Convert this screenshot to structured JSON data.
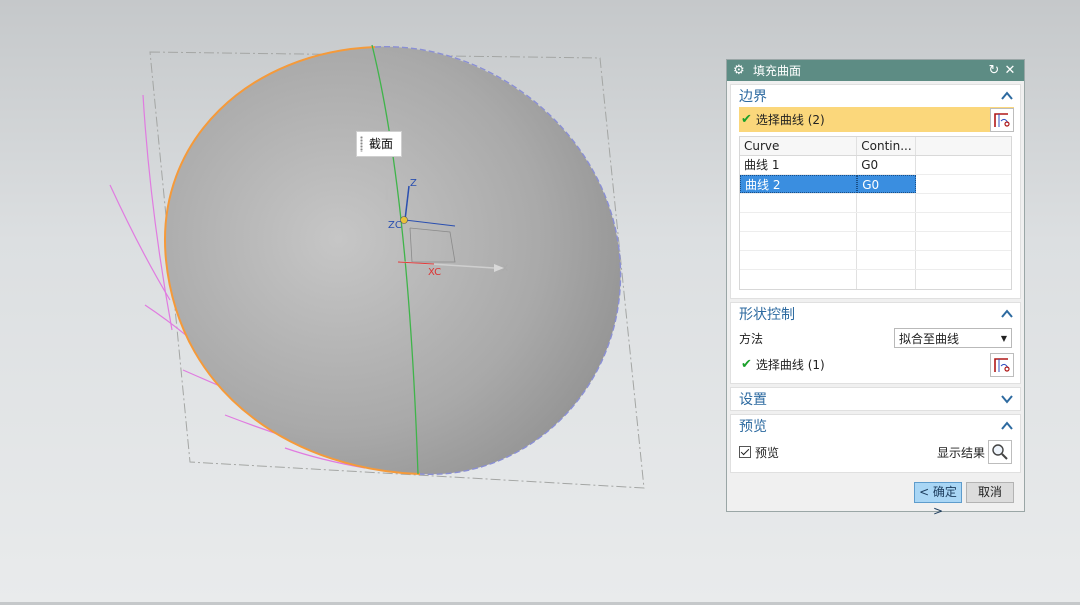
{
  "viewport": {
    "label_tag": "截面",
    "axis_labels": {
      "z": "Z",
      "zc": "ZC",
      "xc": "XC",
      "x": "X"
    }
  },
  "dialog": {
    "title": "填充曲面",
    "boundary": {
      "heading": "边界",
      "select_label": "选择曲线 (2)",
      "columns": [
        "Curve",
        "Contin..."
      ],
      "rows": [
        {
          "curve": "曲线 1",
          "continuity": "G0",
          "selected": false
        },
        {
          "curve": "曲线 2",
          "continuity": "G0",
          "selected": true
        }
      ]
    },
    "shape_control": {
      "heading": "形状控制",
      "method_label": "方法",
      "method_value": "拟合至曲线",
      "select_label": "选择曲线 (1)"
    },
    "settings": {
      "heading": "设置"
    },
    "preview": {
      "heading": "预览",
      "checkbox_label": "预览",
      "checked": true,
      "show_result_label": "显示结果"
    },
    "footer": {
      "ok_label": "< 确定 >",
      "cancel_label": "取消"
    }
  },
  "colors": {
    "title_bar": "#5d8c84",
    "group_heading": "#2d6aa0",
    "selection_highlight": "#fbd77b",
    "row_selected": "#3a8ee0",
    "check_green": "#1aa02a"
  }
}
